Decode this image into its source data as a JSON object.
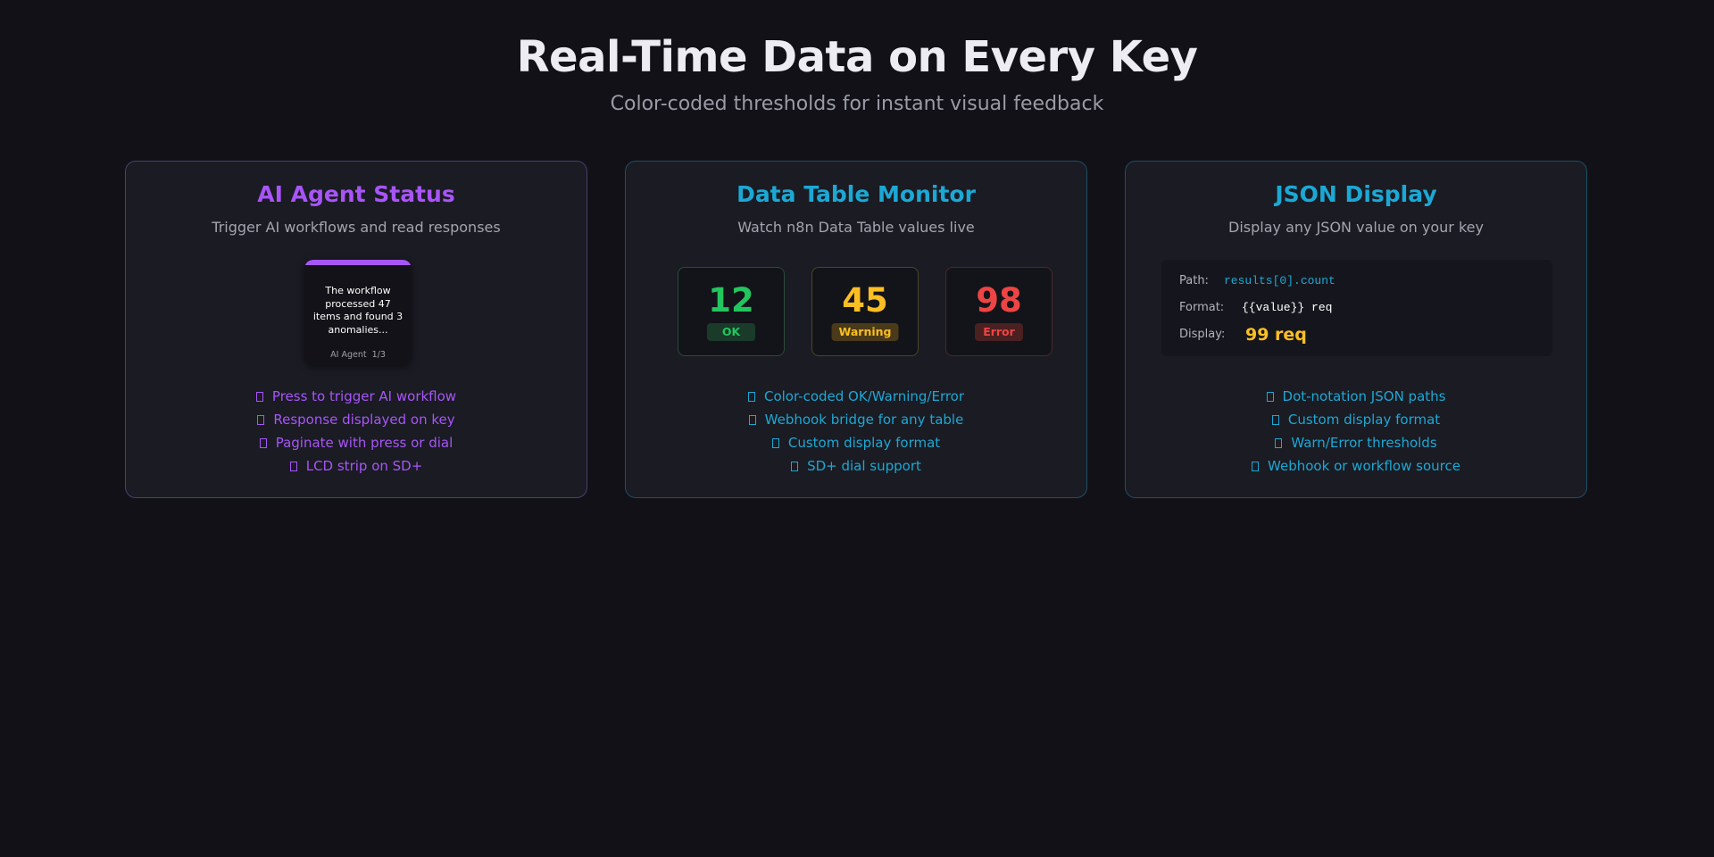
{
  "hero": {
    "title": "Real-Time Data on Every Key",
    "subtitle": "Color-coded thresholds for instant visual feedback"
  },
  "colors": {
    "background": "#111117",
    "card": "#1a1b23",
    "purple": "#a855f7",
    "cyan": "#1ca8d4",
    "ok": "#22c55e",
    "warning": "#fbbf24",
    "error": "#ef4444"
  },
  "cards": [
    {
      "title": "AI Agent Status",
      "subtitle": "Trigger AI workflows and read responses",
      "key": {
        "text": "The workflow processed 47 items and found 3 anomalies...",
        "label": "AI Agent",
        "page": "1/3"
      },
      "features": [
        "Press to trigger AI workflow",
        "Response displayed on key",
        "Paginate with press or dial",
        "LCD strip on SD+"
      ]
    },
    {
      "title": "Data Table Monitor",
      "subtitle": "Watch n8n Data Table values live",
      "keys": [
        {
          "value": "12",
          "status": "OK"
        },
        {
          "value": "45",
          "status": "Warning"
        },
        {
          "value": "98",
          "status": "Error"
        }
      ],
      "features": [
        "Color-coded OK/Warning/Error",
        "Webhook bridge for any table",
        "Custom display format",
        "SD+ dial support"
      ]
    },
    {
      "title": "JSON Display",
      "subtitle": "Display any JSON value on your key",
      "panel": {
        "path_label": "Path:",
        "path_value": "results[0].count",
        "format_label": "Format:",
        "format_value": "{{value}} req",
        "display_label": "Display:",
        "display_value": "99 req"
      },
      "features": [
        "Dot-notation JSON paths",
        "Custom display format",
        "Warn/Error thresholds",
        "Webhook or workflow source"
      ]
    }
  ]
}
